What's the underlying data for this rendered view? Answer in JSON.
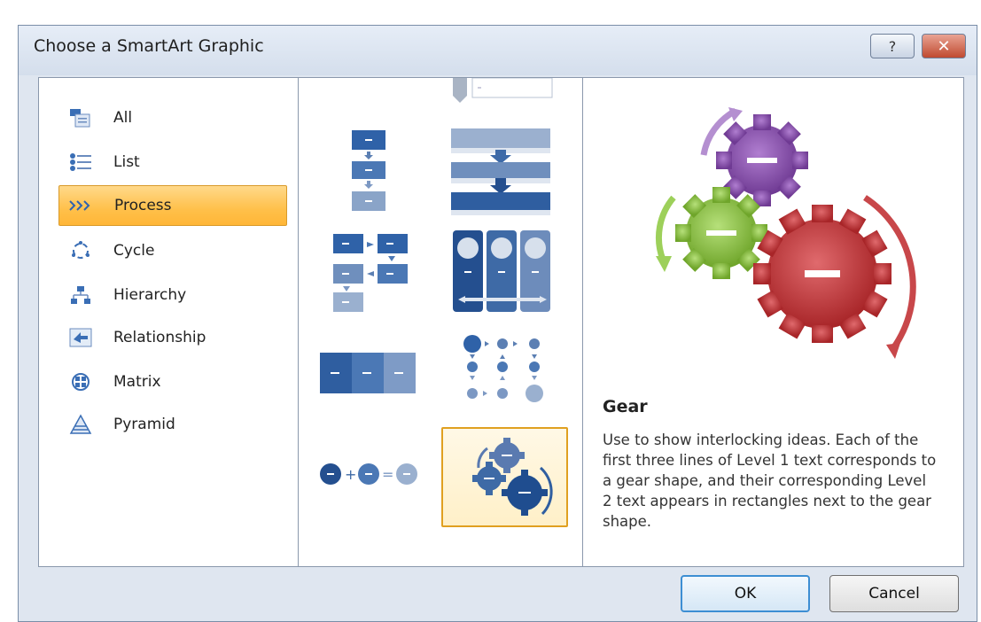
{
  "window": {
    "title": "Choose a SmartArt Graphic",
    "help_label": "?",
    "close_label": "✕"
  },
  "categories": [
    {
      "label": "All",
      "icon": "all-icon"
    },
    {
      "label": "List",
      "icon": "list-icon"
    },
    {
      "label": "Process",
      "icon": "process-icon",
      "selected": true
    },
    {
      "label": "Cycle",
      "icon": "cycle-icon"
    },
    {
      "label": "Hierarchy",
      "icon": "hierarchy-icon"
    },
    {
      "label": "Relationship",
      "icon": "relationship-icon"
    },
    {
      "label": "Matrix",
      "icon": "matrix-icon"
    },
    {
      "label": "Pyramid",
      "icon": "pyramid-icon"
    }
  ],
  "layouts": [
    {
      "icon": "vertical-chevron-list-icon"
    },
    {
      "icon": "basic-vertical-process-icon"
    },
    {
      "icon": "vertical-arrow-bands-icon"
    },
    {
      "icon": "snake-process-icon"
    },
    {
      "icon": "circle-accent-columns-icon"
    },
    {
      "icon": "basic-timeline-bars-icon"
    },
    {
      "icon": "circle-flow-grid-icon"
    },
    {
      "icon": "equation-icon"
    },
    {
      "icon": "gear-layout-icon",
      "selected": true
    }
  ],
  "preview": {
    "title": "Gear",
    "description": "Use to show interlocking ideas. Each of the first three lines of Level 1 text corresponds to a gear shape, and their corresponding Level 2 text appears in rectangles next to the gear shape.",
    "gear_colors": {
      "purple": "#8a4fae",
      "green": "#8fc53f",
      "red": "#c8373a"
    }
  },
  "buttons": {
    "ok": "OK",
    "cancel": "Cancel"
  }
}
